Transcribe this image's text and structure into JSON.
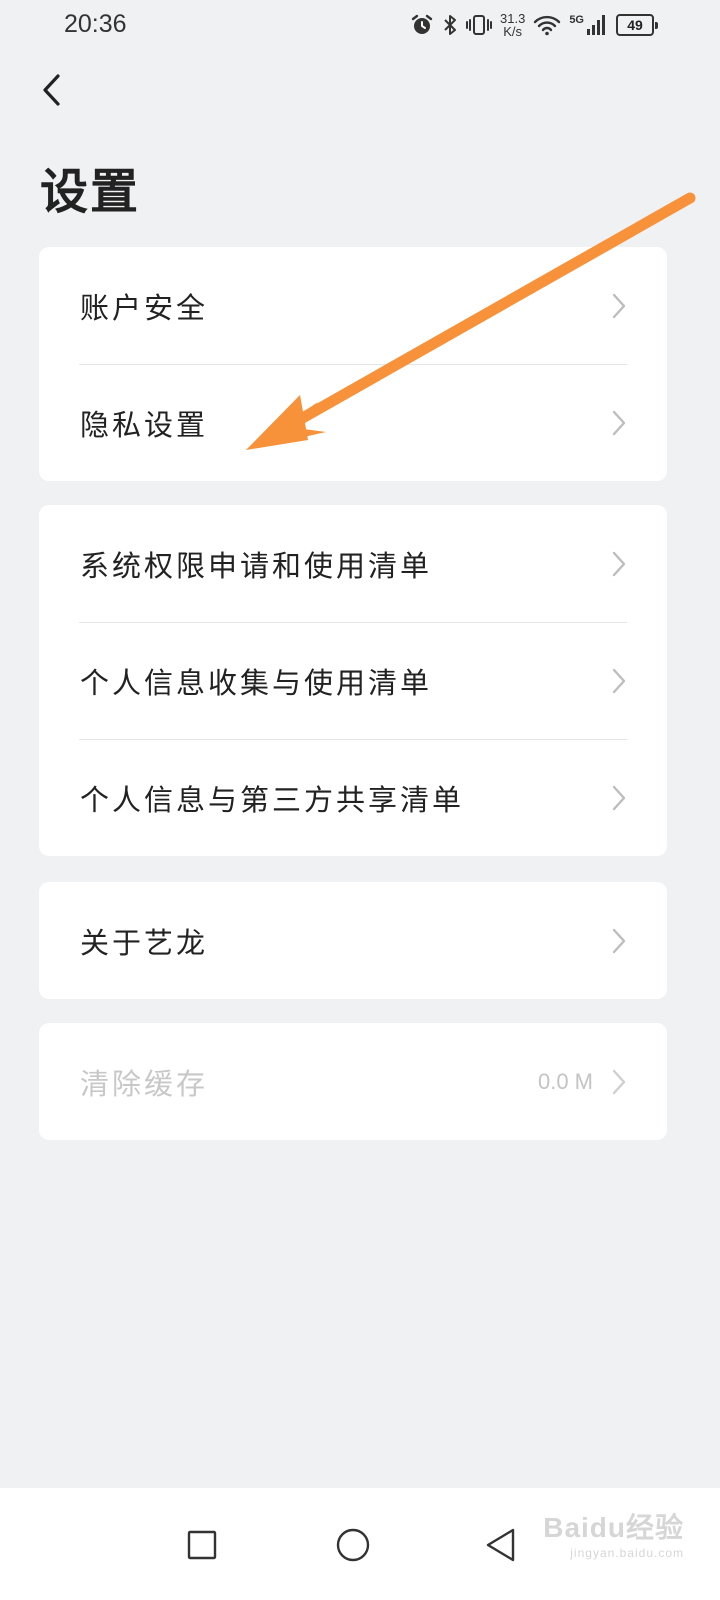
{
  "status_bar": {
    "time": "20:36",
    "network_speed_value": "31.3",
    "network_speed_unit": "K/s",
    "signal_label": "5G",
    "battery": "49",
    "icons": [
      "alarm-icon",
      "bluetooth-icon",
      "vibrate-icon",
      "wifi-icon",
      "cellular-signal-icon",
      "battery-icon"
    ]
  },
  "header": {
    "back_icon": "chevron-left-icon",
    "title": "设置"
  },
  "groups": [
    {
      "items": [
        {
          "label": "账户安全"
        },
        {
          "label": "隐私设置"
        }
      ]
    },
    {
      "items": [
        {
          "label": "系统权限申请和使用清单"
        },
        {
          "label": "个人信息收集与使用清单"
        },
        {
          "label": "个人信息与第三方共享清单"
        }
      ]
    },
    {
      "items": [
        {
          "label": "关于艺龙"
        }
      ]
    },
    {
      "items": [
        {
          "label": "清除缓存",
          "value": "0.0 M",
          "disabled": true
        }
      ]
    }
  ],
  "annotation": {
    "color": "#f7913a",
    "target": "隐私设置"
  },
  "nav_bar": {
    "buttons": [
      "recent-apps-icon",
      "home-icon",
      "back-triangle-icon"
    ],
    "watermark_logo": "Baidu经验",
    "watermark_url": "jingyan.baidu.com"
  },
  "colors": {
    "background": "#f0f1f3",
    "card": "#ffffff",
    "text": "#222222",
    "disabled_text": "#c8c8c8",
    "chevron": "#bdbdbd"
  }
}
